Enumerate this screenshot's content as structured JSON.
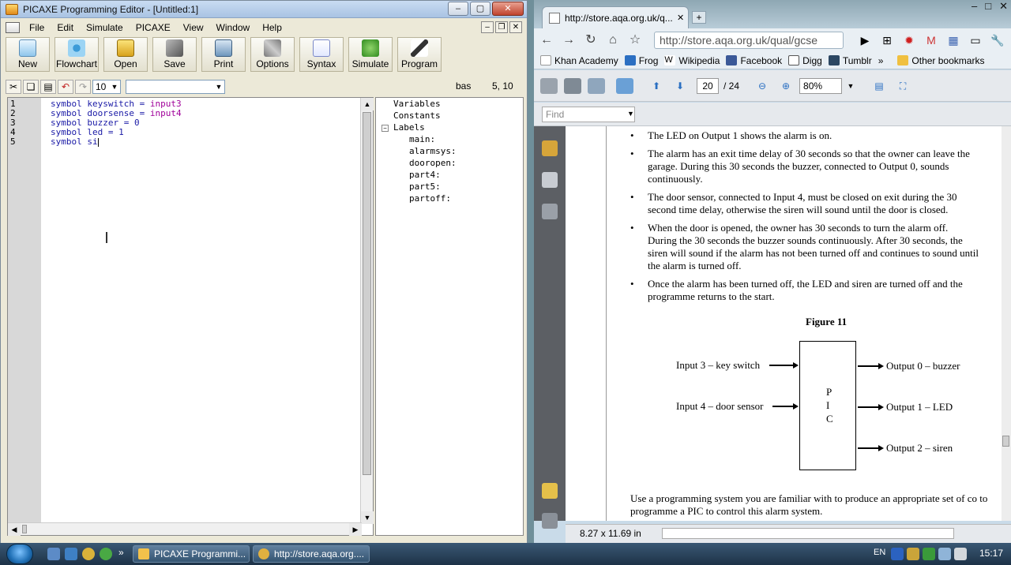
{
  "picaxe": {
    "title": "PICAXE Programming Editor  - [Untitled:1]",
    "menu": [
      "File",
      "Edit",
      "Simulate",
      "PICAXE",
      "View",
      "Window",
      "Help"
    ],
    "toolbar": [
      "New",
      "Flowchart",
      "Open",
      "Save",
      "Print",
      "Options",
      "Syntax",
      "Simulate",
      "Program"
    ],
    "font_size": "10",
    "font_name": "",
    "mode": "bas",
    "cursor_pos": "5, 10",
    "line_numbers": [
      "1",
      "2",
      "3",
      "4",
      "5"
    ],
    "code": [
      {
        "text": "symbol keyswitch = ",
        "value": "input3"
      },
      {
        "text": "symbol doorsense = ",
        "value": "input4"
      },
      {
        "text": "symbol buzzer = 0",
        "value": ""
      },
      {
        "text": "symbol led = 1",
        "value": ""
      },
      {
        "text": "symbol si",
        "value": ""
      }
    ],
    "tree": {
      "variables": "Variables",
      "constants": "Constants",
      "labels": "Labels",
      "label_items": [
        "main:",
        "alarmsys:",
        "dooropen:",
        "part4:",
        "part5:",
        "partoff:"
      ]
    }
  },
  "chrome": {
    "tab_title": "http://store.aqa.org.uk/q...",
    "url": "http://store.aqa.org.uk/qual/gcse",
    "bookmarks": [
      "Khan Academy",
      "Frog",
      "Wikipedia",
      "Facebook",
      "Digg",
      "Tumblr"
    ],
    "other_bookmarks": "Other bookmarks",
    "pdf": {
      "page": "20",
      "page_total": "/ 24",
      "zoom": "80%",
      "find_placeholder": "Find",
      "page_size": "8.27 x 11.69 in",
      "bullets": [
        "The LED on Output 1 shows the alarm is on.",
        "The alarm has an exit time delay of 30 seconds so that the owner can leave the garage.  During this 30 seconds the buzzer, connected to Output 0, sounds continuously.",
        "The door sensor, connected to Input 4, must be closed on exit during the 30 second time delay, otherwise the siren will sound until the door is closed.",
        "When the door is opened, the owner has 30 seconds to turn the alarm off. During the 30 seconds the buzzer sounds continuously.  After 30 seconds, the siren will sound if the alarm has not been turned off and continues to sound until the alarm is turned off.",
        "Once the alarm has been turned off, the LED and siren are turned off and the programme returns to the start."
      ],
      "figure_title": "Figure 11",
      "inputs": [
        "Input 3 – key switch",
        "Input 4 – door sensor"
      ],
      "outputs": [
        "Output 0 – buzzer",
        "Output 1 – LED",
        "Output 2 – siren"
      ],
      "pic_letters": [
        "P",
        "I",
        "C"
      ],
      "closing": "Use a programming system you are familiar with to produce an appropriate set of co to programme a PIC to control this alarm system."
    }
  },
  "taskbar": {
    "tasks": [
      "PICAXE Programmi...",
      "http://store.aqa.org...."
    ],
    "lang": "EN",
    "clock": "15:17"
  }
}
